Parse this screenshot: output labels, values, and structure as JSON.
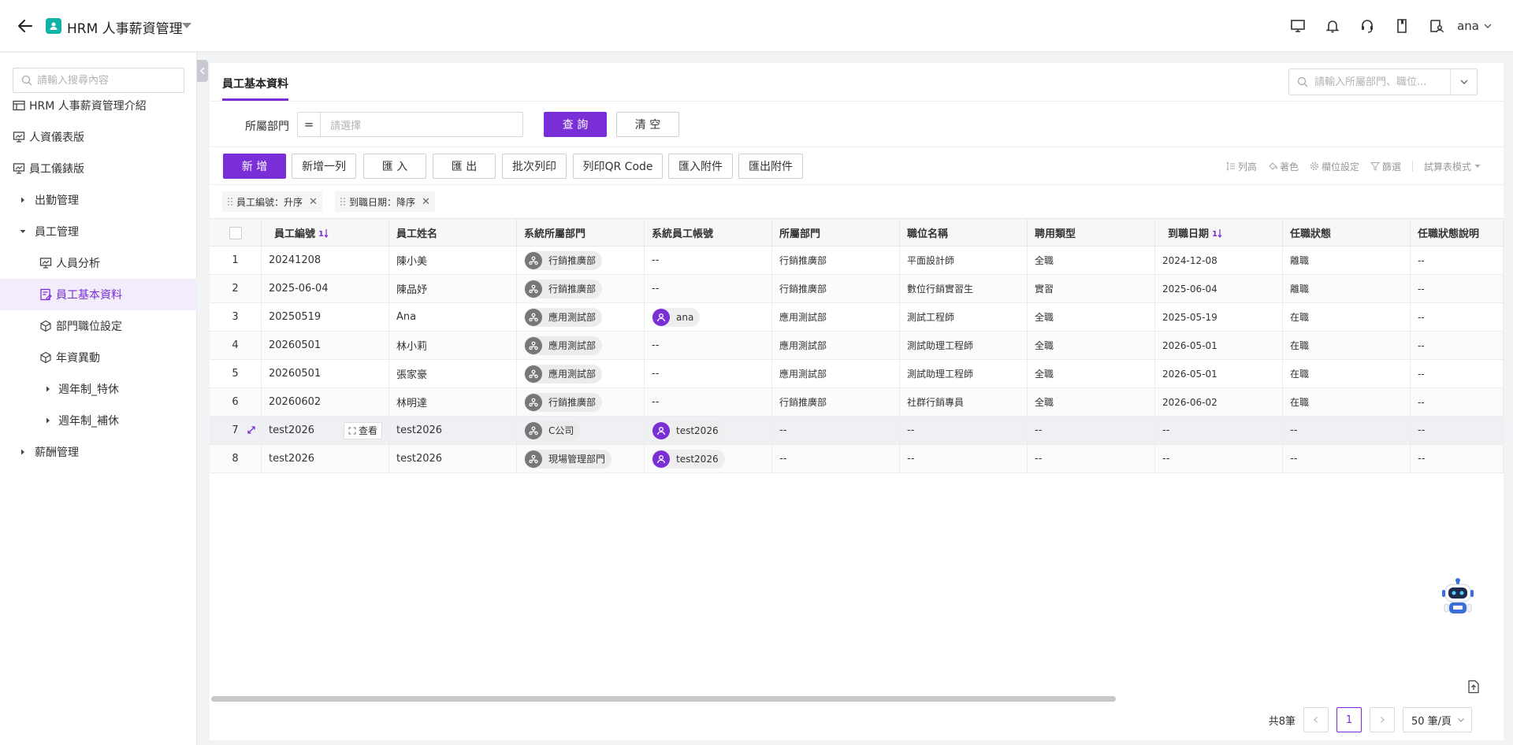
{
  "app": {
    "title": "HRM 人事薪資管理",
    "user": "ana",
    "accent": "#7a2ed6"
  },
  "sidebar": {
    "search_placeholder": "請輸入搜尋內容",
    "items": [
      {
        "label": "HRM 人事薪資管理介紹",
        "icon": "table-icon"
      },
      {
        "label": "人資儀表版",
        "icon": "dashboard-icon"
      },
      {
        "label": "員工儀錶版",
        "icon": "dashboard-icon"
      },
      {
        "label": "出勤管理",
        "icon": "caret-right-icon"
      },
      {
        "label": "員工管理",
        "icon": "caret-down-icon"
      },
      {
        "label": "人員分析",
        "icon": "dashboard-icon"
      },
      {
        "label": "員工基本資料",
        "icon": "form-icon"
      },
      {
        "label": "部門職位設定",
        "icon": "cube-icon"
      },
      {
        "label": "年資異動",
        "icon": "cube-icon"
      },
      {
        "label": "週年制_特休",
        "icon": "caret-right-icon"
      },
      {
        "label": "週年制_補休",
        "icon": "caret-right-icon"
      },
      {
        "label": "薪酬管理",
        "icon": "caret-right-icon"
      }
    ]
  },
  "tab": {
    "label": "員工基本資料"
  },
  "top_search": {
    "placeholder": "請輸入所屬部門、職位..."
  },
  "filter": {
    "label": "所屬部門",
    "operator": "=",
    "placeholder": "請選擇",
    "query": "查 詢",
    "clear": "清 空"
  },
  "toolbar": {
    "buttons": [
      "新 增",
      "新增一列",
      "匯 入",
      "匯 出",
      "批次列印",
      "列印QR Code",
      "匯入附件",
      "匯出附件"
    ],
    "right": [
      "列高",
      "著色",
      "欄位設定",
      "篩選",
      "試算表模式"
    ]
  },
  "sorts": [
    "員工編號：升序",
    "到職日期：降序"
  ],
  "table": {
    "columns": [
      "員工編號",
      "員工姓名",
      "系統所屬部門",
      "系統員工帳號",
      "所屬部門",
      "職位名稱",
      "聘用類型",
      "到職日期",
      "任職狀態",
      "任職狀態說明"
    ],
    "view_label": "查看",
    "rows": [
      [
        "1",
        "20241208",
        "陳小美",
        "行銷推廣部",
        "--",
        "行銷推廣部",
        "平面設計師",
        "全職",
        "2024-12-08",
        "離職",
        "--"
      ],
      [
        "2",
        "2025-06-04",
        "陳品妤",
        "行銷推廣部",
        "--",
        "行銷推廣部",
        "數位行銷實習生",
        "實習",
        "2025-06-04",
        "離職",
        "--"
      ],
      [
        "3",
        "20250519",
        "Ana",
        "應用測試部",
        "ana",
        "應用測試部",
        "測試工程師",
        "全職",
        "2025-05-19",
        "在職",
        "--"
      ],
      [
        "4",
        "20260501",
        "林小莉",
        "應用測試部",
        "--",
        "應用測試部",
        "測試助理工程師",
        "全職",
        "2026-05-01",
        "在職",
        "--"
      ],
      [
        "5",
        "20260501",
        "張家豪",
        "應用測試部",
        "--",
        "應用測試部",
        "測試助理工程師",
        "全職",
        "2026-05-01",
        "在職",
        "--"
      ],
      [
        "6",
        "20260602",
        "林明達",
        "行銷推廣部",
        "--",
        "行銷推廣部",
        "社群行銷專員",
        "全職",
        "2026-06-02",
        "在職",
        "--"
      ],
      [
        "7",
        "test2026",
        "test2026",
        "C公司",
        "test2026",
        "--",
        "--",
        "--",
        "--",
        "--",
        "--"
      ],
      [
        "8",
        "test2026",
        "test2026",
        "現場管理部門",
        "test2026",
        "--",
        "--",
        "--",
        "--",
        "--",
        "--"
      ]
    ]
  },
  "pager": {
    "total": "共8筆",
    "page": "1",
    "size": "50 筆/頁"
  }
}
